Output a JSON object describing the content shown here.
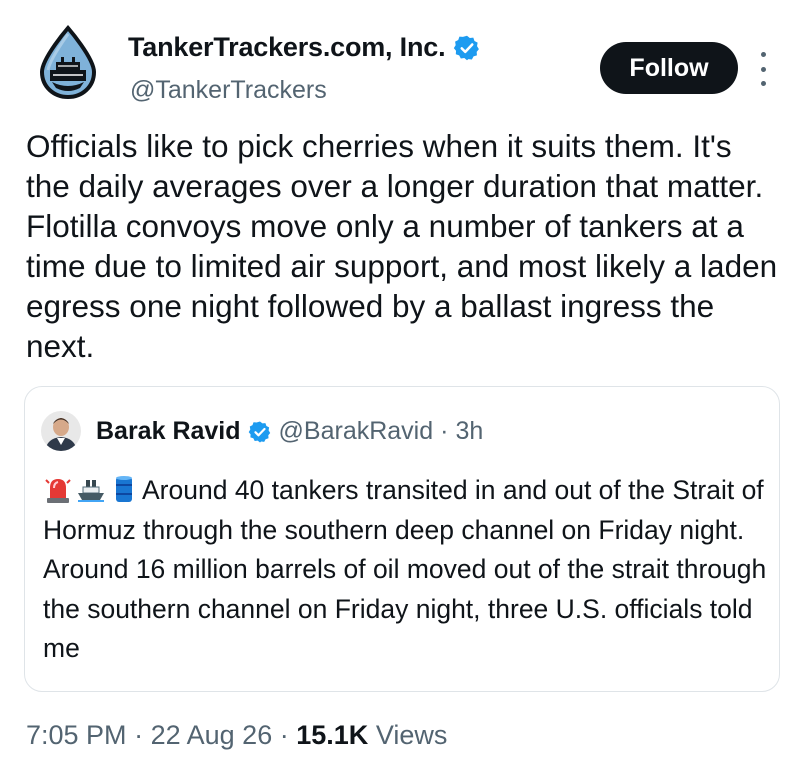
{
  "author": {
    "name": "TankerTrackers.com, Inc.",
    "handle": "@TankerTrackers",
    "avatar_icon": "water-drop-ship-logo",
    "verified": true
  },
  "actions": {
    "follow_label": "Follow",
    "more_icon": "more-vertical-icon"
  },
  "tweet": {
    "text": "Officials like to pick cherries when it suits them. It's the daily averages over a longer duration that matter. Flotilla convoys move only a number of tankers at a time due to limited air support, and most likely a laden egress one night followed by a ballast ingress the next."
  },
  "quote": {
    "author_name": "Barak Ravid",
    "handle": "@BarakRavid",
    "separator": "·",
    "time": "3h",
    "verified": true,
    "emojis": [
      "siren-emoji",
      "ship-emoji",
      "oil-drum-emoji"
    ],
    "text": "Around 40 tankers transited in and out of the Strait of Hormuz through the southern deep channel on Friday night. Around 16 million barrels of oil moved out of the strait through the southern channel on Friday night, three U.S. officials told me"
  },
  "meta": {
    "time": "7:05 PM",
    "dot1": "·",
    "date": "22 Aug 26",
    "dot2": "·",
    "views_count": "15.1K",
    "views_label": "Views"
  },
  "colors": {
    "text": "#0f1419",
    "muted": "#536471",
    "verified_blue": "#1d9bf0",
    "border": "#dfe4e8",
    "button_bg": "#0f1419"
  }
}
